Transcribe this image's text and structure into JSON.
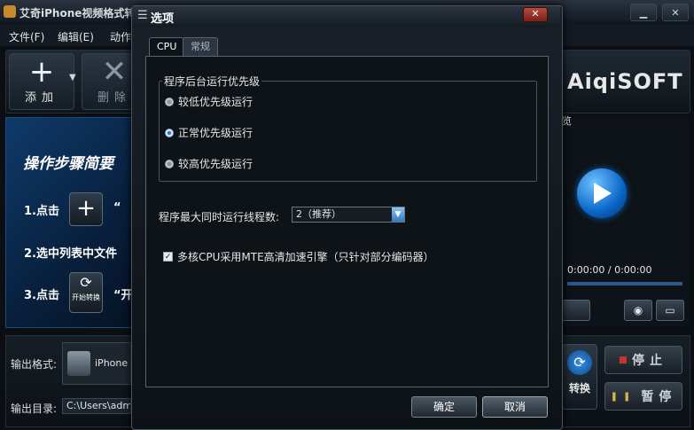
{
  "main_window": {
    "title": "艾奇iPhone视频格式转",
    "menu": [
      "文件(F)",
      "编辑(E)",
      "动作"
    ],
    "toolbar": {
      "add_label": "添加",
      "delete_label": "删除"
    },
    "brand": "AiqiSOFT",
    "guide": {
      "title": "操作步骤简要",
      "step1": "1.点击",
      "step1_quote": "“",
      "step2": "2.选中列表中文件",
      "step3": "3.点击",
      "step3_quote": "“开",
      "start_icon_label": "开始转换"
    },
    "output": {
      "format_label": "输出格式:",
      "format_value": "iPhone 视",
      "dir_label": "输出目录:",
      "dir_value": "C:\\Users\\admin"
    },
    "preview": {
      "time": "0:00:00 / 0:00:00",
      "partial_label": "览"
    },
    "controls": {
      "stop": "停止",
      "pause": "暂停",
      "convert_partial": "转换"
    }
  },
  "dialog": {
    "title": "选项",
    "close_symbol": "✕",
    "tabs": [
      {
        "label": "CPU",
        "active": true
      },
      {
        "label": "常规",
        "active": false
      }
    ],
    "priority_group": {
      "legend": "程序后台运行优先级",
      "options": [
        {
          "label": "较低优先级运行",
          "selected": false
        },
        {
          "label": "正常优先级运行",
          "selected": true
        },
        {
          "label": "较高优先级运行",
          "selected": false
        }
      ]
    },
    "threads": {
      "label": "程序最大同时运行线程数:",
      "value": "2（推荐）"
    },
    "mte": {
      "label": "多核CPU采用MTE高清加速引擎（只针对部分编码器）",
      "checked": true
    },
    "buttons": {
      "ok": "确定",
      "cancel": "取消"
    }
  },
  "colors": {
    "dialog_bg": "#0e1318",
    "accent_blue": "#2f7ac0",
    "close_red": "#b64b3d"
  }
}
